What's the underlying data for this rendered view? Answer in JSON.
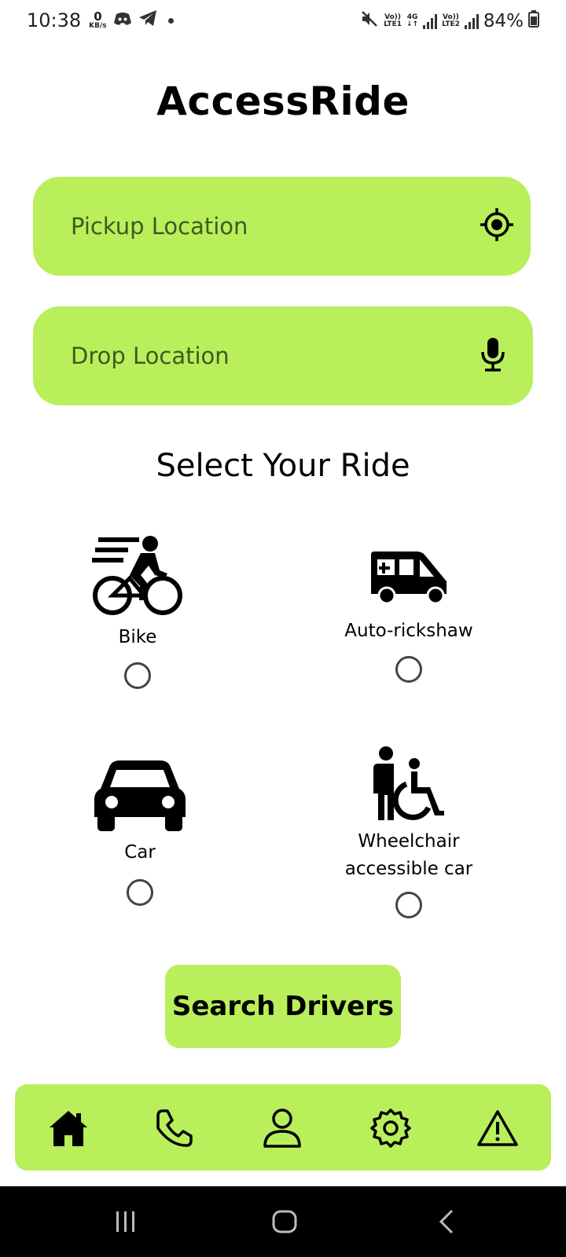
{
  "status_bar": {
    "time": "10:38",
    "data_speed_value": "0",
    "data_speed_unit": "KB/s",
    "sim1_label_top": "Vo))",
    "sim1_label_bottom": "LTE1",
    "network_type": "4G",
    "sim2_label_top": "Vo))",
    "sim2_label_bottom": "LTE2",
    "battery": "84%",
    "icons": [
      "discord-icon",
      "telegram-icon",
      "notification-dot-icon",
      "mute-icon",
      "signal-icon",
      "battery-icon"
    ]
  },
  "app": {
    "title": "AccessRide"
  },
  "inputs": {
    "pickup_placeholder": "Pickup Location",
    "drop_placeholder": "Drop Location"
  },
  "rides": {
    "title": "Select Your Ride",
    "options": [
      {
        "label": "Bike",
        "icon": "bike-icon",
        "selected": false
      },
      {
        "label": "Auto-rickshaw",
        "icon": "auto-rickshaw-icon",
        "selected": false
      },
      {
        "label": "Car",
        "icon": "car-icon",
        "selected": false
      },
      {
        "label_line1": "Wheelchair",
        "label_line2": "accessible car",
        "icon": "wheelchair-icon",
        "selected": false
      }
    ]
  },
  "search_button": {
    "label": "Search Drivers"
  },
  "bottom_nav": {
    "items": [
      "home-icon",
      "phone-icon",
      "profile-icon",
      "settings-icon",
      "alert-icon"
    ]
  },
  "colors": {
    "accent": "#b8ef5b",
    "text": "#000000",
    "placeholder": "#3f5a1f"
  }
}
